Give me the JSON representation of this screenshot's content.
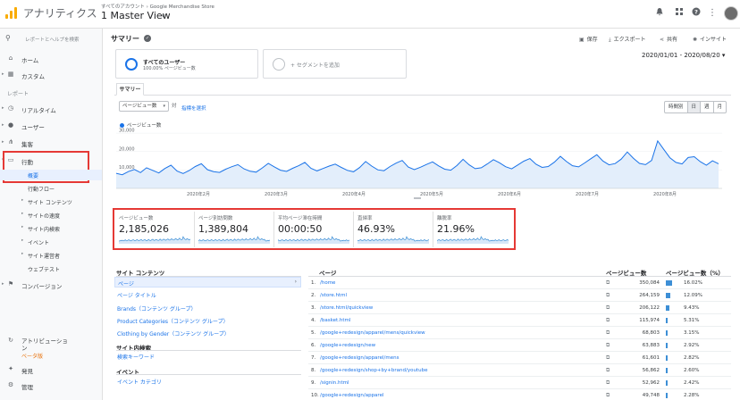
{
  "header": {
    "app_name": "アナリティクス",
    "breadcrumb": "すべてのアカウント › Google Merchandise Store",
    "view_name": "1 Master View"
  },
  "sidebar": {
    "search_placeholder": "レポートとヘルプを検索",
    "items": [
      {
        "label": "ホーム",
        "icon": "home-icon"
      },
      {
        "label": "カスタム",
        "icon": "dashboard-icon"
      }
    ],
    "reports_section": "レポート",
    "report_items": [
      {
        "label": "リアルタイム",
        "icon": "clock-icon"
      },
      {
        "label": "ユーザー",
        "icon": "person-icon"
      },
      {
        "label": "集客",
        "icon": "acquisition-icon"
      },
      {
        "label": "行動",
        "icon": "behavior-icon"
      }
    ],
    "behavior_sub": [
      "概要",
      "行動フロー",
      "サイト コンテンツ",
      "サイトの速度",
      "サイト内検索",
      "イベント",
      "サイト運営者",
      "ウェブテスト"
    ],
    "conversions": "コンバージョン",
    "attribution": "アトリビューション",
    "attribution_badge": "ベータ版",
    "discover": "発見",
    "admin": "管理"
  },
  "main": {
    "title": "サマリー",
    "actions": {
      "save": "保存",
      "export": "エクスポート",
      "share": "共有",
      "insight": "インサイト"
    },
    "segment": {
      "name": "すべてのユーザー",
      "sub": "100.00% ページビュー数",
      "add": "+ セグメントを追加"
    },
    "date_range": "2020/01/01 - 2020/08/20",
    "tab": "サマリー",
    "metric_select": "ページビュー数",
    "vs": "対",
    "pick_metric": "指標を選択",
    "periods": [
      "時間別",
      "日",
      "週",
      "月"
    ],
    "legend": "ページビュー数"
  },
  "chart_data": {
    "type": "line",
    "series": [
      {
        "name": "ページビュー数",
        "values": [
          8200,
          7400,
          9100,
          10300,
          8600,
          11200,
          9800,
          8400,
          10800,
          12600,
          9400,
          8100,
          9700,
          11900,
          13400,
          10200,
          9100,
          8700,
          10400,
          11800,
          12900,
          10600,
          9300,
          8800,
          11100,
          13600,
          11700,
          9900,
          9200,
          10900,
          12300,
          14100,
          10900,
          9500,
          10800,
          12100,
          13200,
          11400,
          9800,
          9000,
          11300,
          14600,
          12100,
          10100,
          9600,
          11900,
          13700,
          15200,
          11600,
          10200,
          11500,
          13000,
          14400,
          12200,
          10400,
          9900,
          12400,
          15800,
          12800,
          10700,
          11200,
          13300,
          15600,
          13900,
          11800,
          10600,
          12700,
          14800,
          16200,
          13100,
          11400,
          11900,
          14200,
          17400,
          14600,
          12300,
          11700,
          13800,
          16100,
          18300,
          14900,
          12800,
          13500,
          15900,
          19800,
          16400,
          13600,
          12900,
          15200,
          25800,
          21200,
          16700,
          14100,
          13300,
          16800,
          17200,
          14500,
          12600,
          15000,
          13400
        ]
      }
    ],
    "x_tick_labels": [
      "2020年2月",
      "2020年3月",
      "2020年4月",
      "2020年5月",
      "2020年6月",
      "2020年7月",
      "2020年8月"
    ],
    "y_tick_labels": [
      "10,000",
      "20,000",
      "30,000"
    ],
    "ylim": [
      0,
      32000
    ],
    "grid": true
  },
  "scorecards": [
    {
      "title": "ページビュー数",
      "value": "2,185,026"
    },
    {
      "title": "ページ別訪問数",
      "value": "1,389,804"
    },
    {
      "title": "平均ページ滞在時間",
      "value": "00:00:50"
    },
    {
      "title": "直帰率",
      "value": "46.93%"
    },
    {
      "title": "離脱率",
      "value": "21.96%"
    }
  ],
  "left_panel": {
    "site_content_head": "サイト コンテンツ",
    "active": "ページ",
    "links": [
      "ページ タイトル",
      "Brands（コンテンツ グループ）",
      "Product Categories（コンテンツ グループ）",
      "Clothing by Gender（コンテンツ グループ）"
    ],
    "site_search_head": "サイト内検索",
    "search_link": "検索キーワード",
    "event_head": "イベント",
    "event_link": "イベント カテゴリ"
  },
  "table": {
    "col_page": "ページ",
    "col_views": "ページビュー数",
    "col_pct": "ページビュー数（%）",
    "rows": [
      {
        "idx": "1.",
        "page": "/home",
        "views": "350,084",
        "pct": "16.02%",
        "share": 0.1602
      },
      {
        "idx": "2.",
        "page": "/store.html",
        "views": "264,159",
        "pct": "12.09%",
        "share": 0.1209
      },
      {
        "idx": "3.",
        "page": "/store.html/quickview",
        "views": "206,122",
        "pct": "9.43%",
        "share": 0.0943
      },
      {
        "idx": "4.",
        "page": "/basket.html",
        "views": "115,974",
        "pct": "5.31%",
        "share": 0.0531
      },
      {
        "idx": "5.",
        "page": "/google+redesign/apparel/mens/quickview",
        "views": "68,803",
        "pct": "3.15%",
        "share": 0.0315
      },
      {
        "idx": "6.",
        "page": "/google+redesign/new",
        "views": "63,883",
        "pct": "2.92%",
        "share": 0.0292
      },
      {
        "idx": "7.",
        "page": "/google+redesign/apparel/mens",
        "views": "61,601",
        "pct": "2.82%",
        "share": 0.0282
      },
      {
        "idx": "8.",
        "page": "/google+redesign/shop+by+brand/youtube",
        "views": "56,862",
        "pct": "2.60%",
        "share": 0.026
      },
      {
        "idx": "9.",
        "page": "/signin.html",
        "views": "52,962",
        "pct": "2.42%",
        "share": 0.0242
      },
      {
        "idx": "10.",
        "page": "/google+redesign/apparel",
        "views": "49,748",
        "pct": "2.28%",
        "share": 0.0228
      }
    ]
  },
  "colors": {
    "accent": "#1a73e8",
    "highlight_box": "#e53935",
    "bar": "#3d8fd6"
  }
}
